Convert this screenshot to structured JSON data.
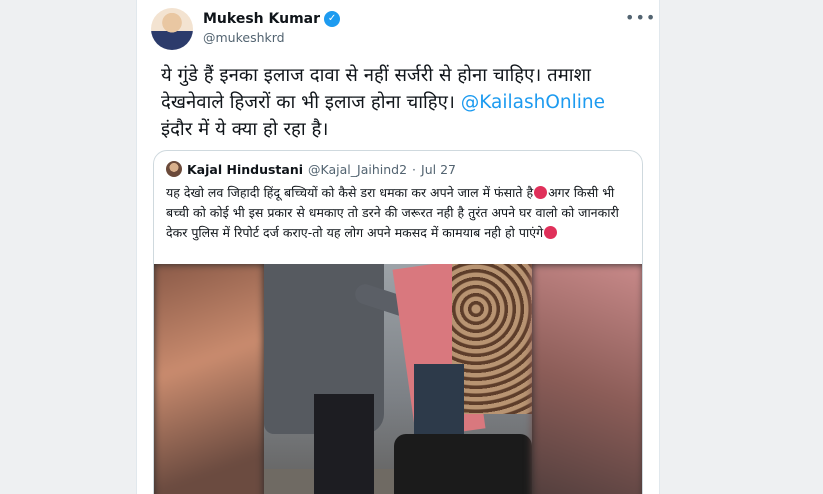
{
  "tweet": {
    "author_name": "Mukesh Kumar",
    "author_handle": "@mukeshkrd",
    "more_icon": "more-horizontal-icon",
    "verified_icon": "verified-badge-icon",
    "text_line1": "ये गुंडे हैं इनका इलाज दावा से नहीं सर्जरी से होना चाहिए। तमाशा",
    "text_line2_prefix": "देखनेवाले हिजरों का भी इलाज होना चाहिए। ",
    "mention": "@KailashOnline",
    "text_line3": "इंदौर में ये क्या हो रहा है।"
  },
  "quote": {
    "author_name": "Kajal Hindustani",
    "author_handle": "@Kajal_Jaihind2",
    "separator": "·",
    "date": "Jul 27",
    "text_part1": "यह देखो लव जिहादी हिंदू बच्चियों को कैसे डरा धमका कर अपने जाल में फंसाते है",
    "text_part2": "अगर किसी भी बच्ची को कोई भी इस प्रकार से धमकाए तो डरने की जरूरत नही है तुरंत अपने घर वालो को जानकारी देकर पुलिस में रिपोर्ट दर्ज कराए-तो यह लोग अपने मकसद में कामयाब नही हो पाएंगे",
    "emoji_icon": "angry-face-icon"
  },
  "colors": {
    "link": "#1d9bf0",
    "secondary_text": "#536471",
    "border": "#cfd9de"
  }
}
